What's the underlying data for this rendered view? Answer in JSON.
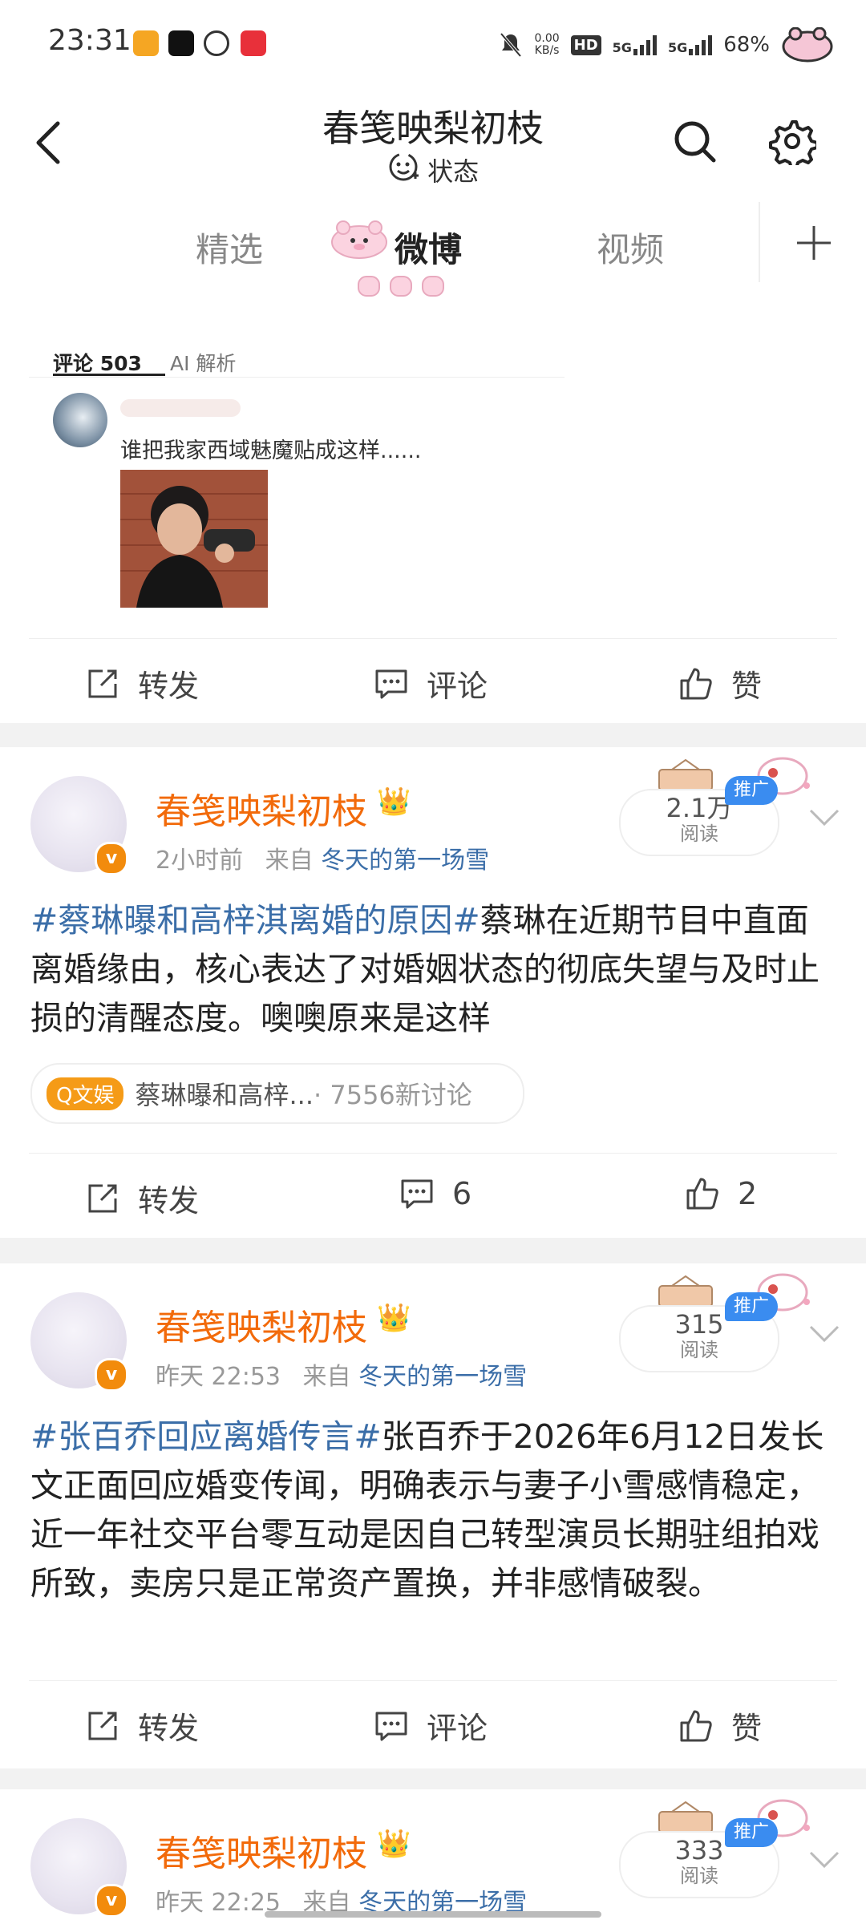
{
  "status_bar": {
    "time": "23:31",
    "net_speed_value": "0.00",
    "net_speed_unit": "KB/s",
    "hd": "HD",
    "sim1": "5G",
    "sim2": "5G",
    "battery": "68%"
  },
  "header": {
    "title": "春笺映梨初枝",
    "status_label": "状态"
  },
  "tabs": [
    {
      "label": "精选"
    },
    {
      "label": "微博"
    },
    {
      "label": "视频"
    }
  ],
  "comment_panel": {
    "tab_comments": "评论 503",
    "tab_ai": "AI 解析",
    "comment_text": "谁把我家西域魅魔贴成这样......"
  },
  "actions": {
    "repost": "转发",
    "comment": "评论",
    "like": "赞"
  },
  "posts": [
    {
      "author": "春笺映梨初枝",
      "time": "2小时前",
      "from_label": "来自",
      "source": "冬天的第一场雪",
      "reads": "2.1万",
      "reads_label": "阅读",
      "ad_label": "推广",
      "topic": "#蔡琳曝和高梓淇离婚的原因#",
      "text": "蔡琳在近期节目中直面离婚缘由，核心表达了对婚姻状态的彻底失望与及时止损的清醒态度。噢噢原来是这样",
      "topic_badge": "Q文娱",
      "topic_pill_text": "蔡琳曝和高梓...",
      "topic_pill_count": "· 7556新讨论",
      "repost": "转发",
      "comments": "6",
      "likes": "2"
    },
    {
      "author": "春笺映梨初枝",
      "time": "昨天 22:53",
      "from_label": "来自",
      "source": "冬天的第一场雪",
      "reads": "315",
      "reads_label": "阅读",
      "ad_label": "推广",
      "topic": "#张百乔回应离婚传言#",
      "text": "张百乔于2026年6月12日发长文正面回应婚变传闻，明确表示与妻子小雪感情稳定，近一年社交平台零互动是因自己转型演员长期驻组拍戏所致，卖房只是正常资产置换，并非感情破裂。",
      "repost": "转发",
      "comment": "评论",
      "like": "赞"
    },
    {
      "author": "春笺映梨初枝",
      "time": "昨天 22:25",
      "from_label": "来自",
      "source": "冬天的第一场雪",
      "reads": "333",
      "reads_label": "阅读",
      "ad_label": "推广"
    }
  ],
  "colors": {
    "accent_orange": "#f26a0a",
    "link_blue": "#3b6ea8",
    "ad_blue": "#3a8cf0"
  }
}
